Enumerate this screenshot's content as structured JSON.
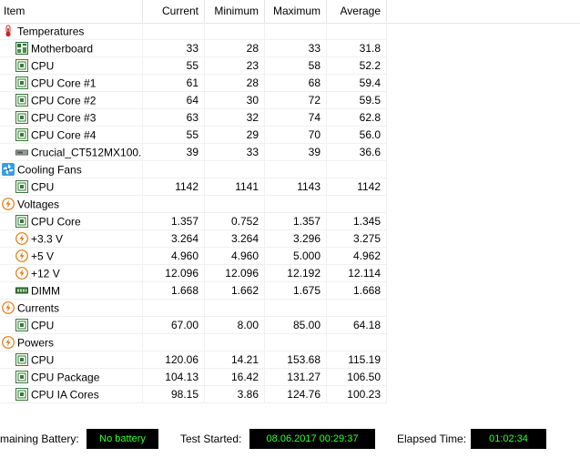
{
  "header": {
    "item": "Item",
    "current": "Current",
    "minimum": "Minimum",
    "maximum": "Maximum",
    "average": "Average"
  },
  "rows": [
    {
      "type": "group",
      "icon": "thermometer-icon",
      "name": "Temperatures",
      "cur": "",
      "min": "",
      "max": "",
      "avg": ""
    },
    {
      "type": "child",
      "icon": "motherboard-icon",
      "name": "Motherboard",
      "cur": "33",
      "min": "28",
      "max": "33",
      "avg": "31.8"
    },
    {
      "type": "child",
      "icon": "chip-icon",
      "name": "CPU",
      "cur": "55",
      "min": "23",
      "max": "58",
      "avg": "52.2"
    },
    {
      "type": "child",
      "icon": "chip-icon",
      "name": "CPU Core #1",
      "cur": "61",
      "min": "28",
      "max": "68",
      "avg": "59.4"
    },
    {
      "type": "child",
      "icon": "chip-icon",
      "name": "CPU Core #2",
      "cur": "64",
      "min": "30",
      "max": "72",
      "avg": "59.5"
    },
    {
      "type": "child",
      "icon": "chip-icon",
      "name": "CPU Core #3",
      "cur": "63",
      "min": "32",
      "max": "74",
      "avg": "62.8"
    },
    {
      "type": "child",
      "icon": "chip-icon",
      "name": "CPU Core #4",
      "cur": "55",
      "min": "29",
      "max": "70",
      "avg": "56.0"
    },
    {
      "type": "child",
      "icon": "drive-icon",
      "name": "Crucial_CT512MX100...",
      "cur": "39",
      "min": "33",
      "max": "39",
      "avg": "36.6"
    },
    {
      "type": "group",
      "icon": "fan-icon",
      "name": "Cooling Fans",
      "cur": "",
      "min": "",
      "max": "",
      "avg": ""
    },
    {
      "type": "child",
      "icon": "chip-icon",
      "name": "CPU",
      "cur": "1142",
      "min": "1141",
      "max": "1143",
      "avg": "1142"
    },
    {
      "type": "group",
      "icon": "lightning-icon",
      "name": "Voltages",
      "cur": "",
      "min": "",
      "max": "",
      "avg": ""
    },
    {
      "type": "child",
      "icon": "chip-icon",
      "name": "CPU Core",
      "cur": "1.357",
      "min": "0.752",
      "max": "1.357",
      "avg": "1.345"
    },
    {
      "type": "child",
      "icon": "lightning-icon",
      "name": "+3.3 V",
      "cur": "3.264",
      "min": "3.264",
      "max": "3.296",
      "avg": "3.275"
    },
    {
      "type": "child",
      "icon": "lightning-icon",
      "name": "+5 V",
      "cur": "4.960",
      "min": "4.960",
      "max": "5.000",
      "avg": "4.962"
    },
    {
      "type": "child",
      "icon": "lightning-icon",
      "name": "+12 V",
      "cur": "12.096",
      "min": "12.096",
      "max": "12.192",
      "avg": "12.114"
    },
    {
      "type": "child",
      "icon": "memory-icon",
      "name": "DIMM",
      "cur": "1.668",
      "min": "1.662",
      "max": "1.675",
      "avg": "1.668"
    },
    {
      "type": "group",
      "icon": "lightning-icon",
      "name": "Currents",
      "cur": "",
      "min": "",
      "max": "",
      "avg": ""
    },
    {
      "type": "child",
      "icon": "chip-icon",
      "name": "CPU",
      "cur": "67.00",
      "min": "8.00",
      "max": "85.00",
      "avg": "64.18"
    },
    {
      "type": "group",
      "icon": "lightning-icon",
      "name": "Powers",
      "cur": "",
      "min": "",
      "max": "",
      "avg": ""
    },
    {
      "type": "child",
      "icon": "chip-icon",
      "name": "CPU",
      "cur": "120.06",
      "min": "14.21",
      "max": "153.68",
      "avg": "115.19"
    },
    {
      "type": "child",
      "icon": "chip-icon",
      "name": "CPU Package",
      "cur": "104.13",
      "min": "16.42",
      "max": "131.27",
      "avg": "106.50"
    },
    {
      "type": "child",
      "icon": "chip-icon",
      "name": "CPU IA Cores",
      "cur": "98.15",
      "min": "3.86",
      "max": "124.76",
      "avg": "100.23"
    }
  ],
  "status": {
    "battery_label": "maining Battery:",
    "battery_value": "No battery",
    "test_label": "Test Started:",
    "test_value": "08.06.2017 00:29:37",
    "elapsed_label": "Elapsed Time:",
    "elapsed_value": "01:02:34"
  },
  "colors": {
    "status_text": "#33ff33",
    "status_bg": "#000000",
    "chip_green": "#3a7a3a",
    "lightning_orange": "#e07a10"
  }
}
